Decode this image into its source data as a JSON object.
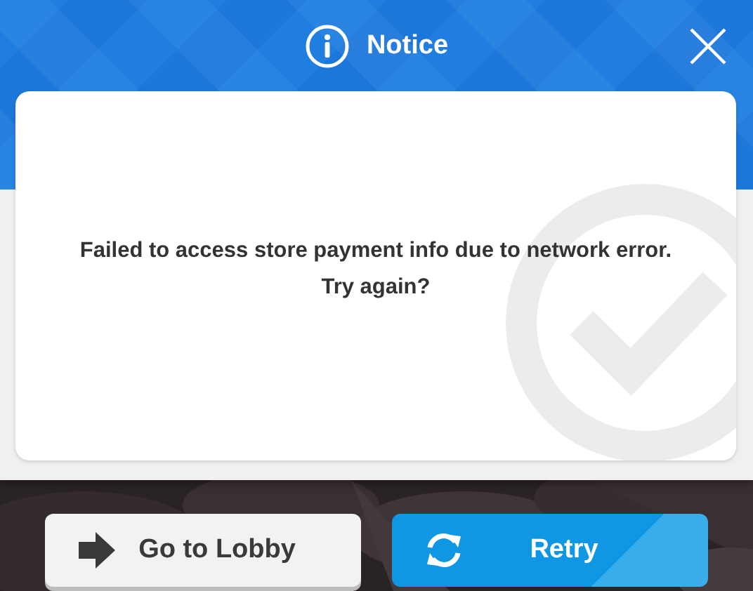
{
  "dialog": {
    "title": "Notice",
    "message": "Failed to access store payment info due to network error.\nTry again?"
  },
  "buttons": [
    {
      "label": "Go to Lobby",
      "kind": "secondary"
    },
    {
      "label": "Retry",
      "kind": "primary"
    }
  ]
}
